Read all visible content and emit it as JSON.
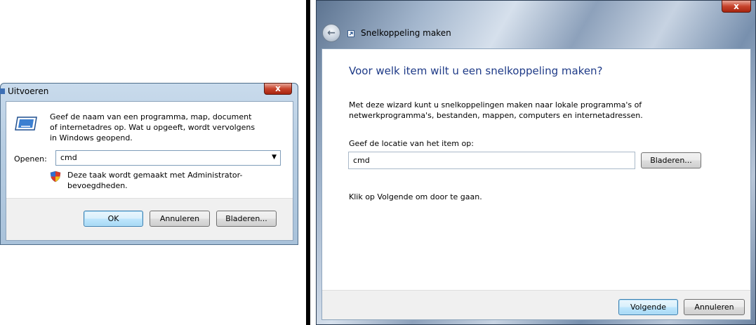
{
  "run_dialog": {
    "title": "Uitvoeren",
    "description": "Geef de naam van een programma, map, document of internetadres op. Wat u opgeeft, wordt vervolgens in Windows geopend.",
    "open_label": "Openen:",
    "open_value": "cmd",
    "admin_note": "Deze taak wordt gemaakt met Administrator-bevoegdheden.",
    "ok_label": "OK",
    "cancel_label": "Annuleren",
    "browse_label": "Bladeren...",
    "close_glyph": "x"
  },
  "shortcut_wizard": {
    "title": "Snelkoppeling maken",
    "heading": "Voor welk item wilt u een snelkoppeling maken?",
    "description": "Met deze wizard kunt u snelkoppelingen maken naar lokale programma's of netwerkprogramma's, bestanden, mappen, computers en internetadressen.",
    "location_label": "Geef de locatie van het item op:",
    "location_value": "cmd",
    "browse_label": "Bladeren...",
    "hint": "Klik op Volgende om door te gaan.",
    "next_label": "Volgende",
    "cancel_label": "Annuleren",
    "back_glyph": "←",
    "close_glyph": "x"
  },
  "colors": {
    "heading_blue": "#1e3a87",
    "default_button_border": "#3c7fb1",
    "close_red": "#c7432c"
  },
  "icons": [
    "run-icon",
    "shield-icon",
    "back-arrow-icon",
    "shortcut-icon",
    "close-icon",
    "dropdown-arrow-icon"
  ]
}
